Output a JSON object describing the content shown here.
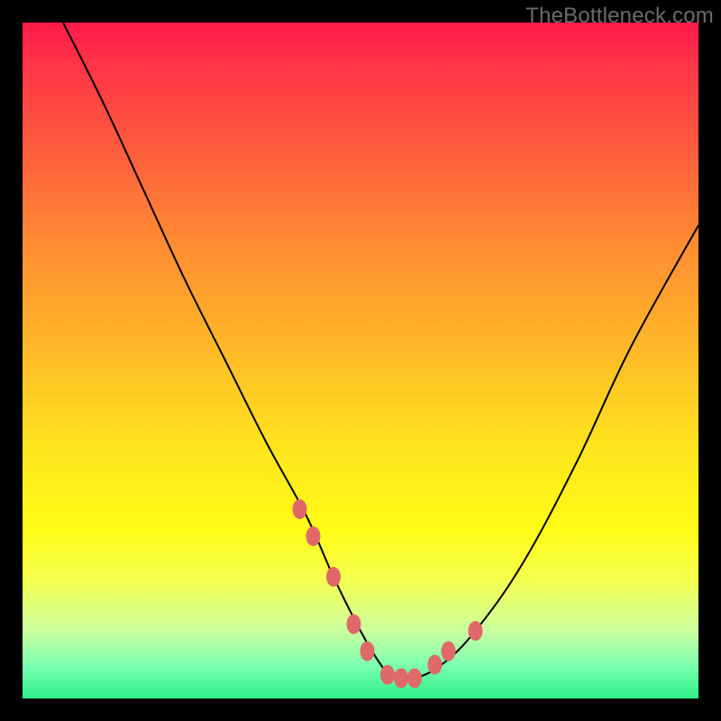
{
  "watermark": "TheBottleneck.com",
  "chart_data": {
    "type": "line",
    "title": "",
    "xlabel": "",
    "ylabel": "",
    "xlim": [
      0,
      100
    ],
    "ylim": [
      0,
      100
    ],
    "series": [
      {
        "name": "curve",
        "x": [
          6,
          12,
          18,
          24,
          30,
          36,
          42,
          46,
          50,
          53,
          55,
          58,
          62,
          67,
          74,
          82,
          90,
          100
        ],
        "values": [
          100,
          88,
          75,
          62,
          50,
          38,
          27,
          18,
          10,
          5,
          3,
          3,
          5,
          10,
          20,
          35,
          52,
          70
        ]
      }
    ],
    "markers": {
      "name": "highlight-points",
      "color": "#e06868",
      "x": [
        41,
        43,
        46,
        49,
        51,
        54,
        56,
        58,
        61,
        63,
        67
      ],
      "values": [
        28,
        24,
        18,
        11,
        7,
        3.5,
        3,
        3,
        5,
        7,
        10
      ]
    },
    "background_gradient": {
      "top": "#ff1a4a",
      "upper_mid": "#ff8c32",
      "mid": "#ffe41e",
      "lower": "#2cf08a"
    }
  }
}
